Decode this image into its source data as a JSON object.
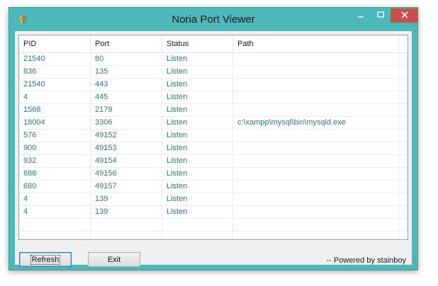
{
  "window": {
    "title": "Noria Port Viewer"
  },
  "icons": {
    "app": "app-logo-icon",
    "minimize": "minimize-icon",
    "maximize": "maximize-icon",
    "close": "close-icon"
  },
  "table": {
    "columns": [
      "PID",
      "Port",
      "Status",
      "Path"
    ],
    "rows": [
      [
        "21540",
        "80",
        "Listen",
        ""
      ],
      [
        "836",
        "135",
        "Listen",
        ""
      ],
      [
        "21540",
        "443",
        "Listen",
        ""
      ],
      [
        "4",
        "445",
        "Listen",
        ""
      ],
      [
        "1568",
        "2179",
        "Listen",
        ""
      ],
      [
        "18004",
        "3306",
        "Listen",
        "c:\\xampp\\mysql\\bin\\mysqld.exe"
      ],
      [
        "576",
        "49152",
        "Listen",
        ""
      ],
      [
        "900",
        "49153",
        "Listen",
        ""
      ],
      [
        "932",
        "49154",
        "Listen",
        ""
      ],
      [
        "688",
        "49156",
        "Listen",
        ""
      ],
      [
        "680",
        "49157",
        "Listen",
        ""
      ],
      [
        "4",
        "139",
        "Listen",
        ""
      ],
      [
        "4",
        "139",
        "Listen",
        ""
      ]
    ],
    "empty_rows": 3
  },
  "buttons": {
    "refresh_label": "Refresh",
    "exit_label": "Exit"
  },
  "footer": {
    "powered_by": "-- Powered by stainboy"
  },
  "colors": {
    "frame": "#4cb8b8",
    "close": "#c7514a",
    "row_text": "#2f7a7a"
  }
}
